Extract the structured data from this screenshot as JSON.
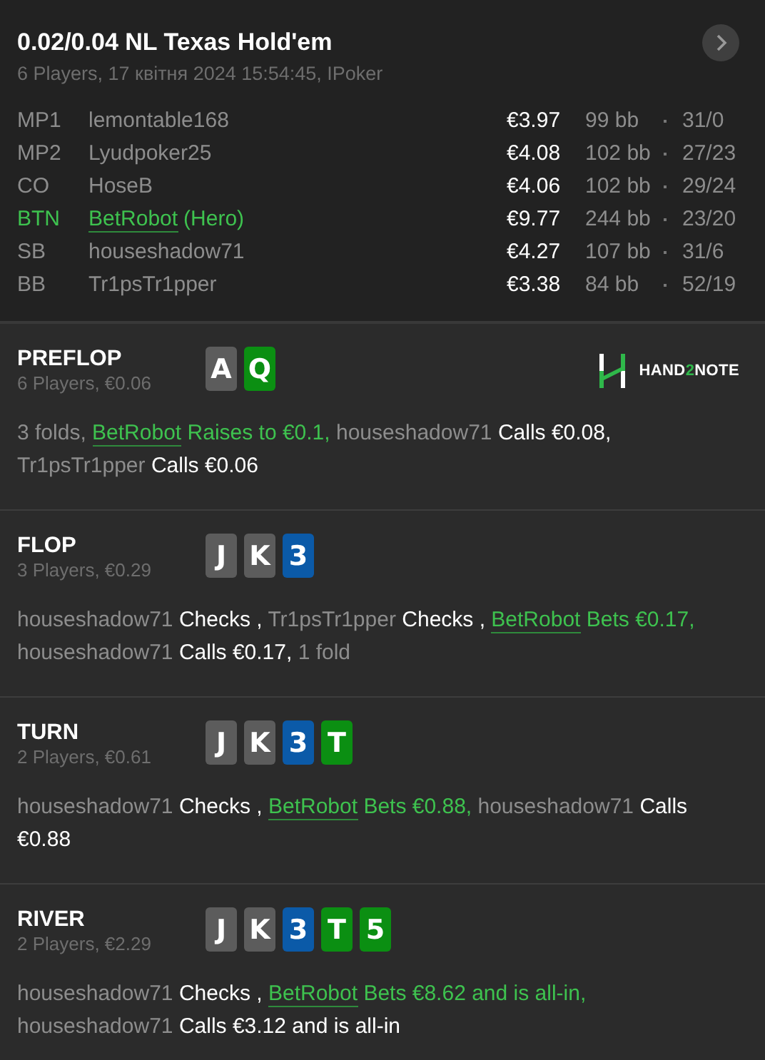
{
  "header": {
    "title": "0.02/0.04 NL Texas Hold'em",
    "subtitle": "6 Players, 17 квітня 2024 15:54:45, IPoker",
    "players": [
      {
        "position": "MP1",
        "name": "lemontable168",
        "hero": false,
        "stack": "€3.97",
        "bb": "99 bb",
        "stats": "31/0"
      },
      {
        "position": "MP2",
        "name": "Lyudpoker25",
        "hero": false,
        "stack": "€4.08",
        "bb": "102 bb",
        "stats": "27/23"
      },
      {
        "position": "CO",
        "name": "HoseB",
        "hero": false,
        "stack": "€4.06",
        "bb": "102 bb",
        "stats": "29/24"
      },
      {
        "position": "BTN",
        "name": "BetRobot",
        "tag": "(Hero)",
        "hero": true,
        "stack": "€9.77",
        "bb": "244 bb",
        "stats": "23/20"
      },
      {
        "position": "SB",
        "name": "houseshadow71",
        "hero": false,
        "stack": "€4.27",
        "bb": "107 bb",
        "stats": "31/6"
      },
      {
        "position": "BB",
        "name": "Tr1psTr1pper",
        "hero": false,
        "stack": "€3.38",
        "bb": "84 bb",
        "stats": "52/19"
      }
    ]
  },
  "logo_text": [
    "HAND",
    "2",
    "NOTE"
  ],
  "streets": [
    {
      "name": "PREFLOP",
      "info": "6 Players, €0.06",
      "logo": true,
      "cards": [
        {
          "rank": "A",
          "color": "#5c5c5c"
        },
        {
          "rank": "Q",
          "color": "#0b8f12"
        }
      ],
      "actions": [
        {
          "kind": "muted",
          "text": "3 folds,"
        },
        {
          "kind": "hero",
          "text": "BetRobot"
        },
        {
          "kind": "hero-action",
          "text": "Raises to €0.1,"
        },
        {
          "kind": "muted",
          "text": "houseshadow71"
        },
        {
          "kind": "action",
          "text": "Calls €0.08,"
        },
        {
          "kind": "muted",
          "text": "Tr1psTr1pper"
        },
        {
          "kind": "action",
          "text": "Calls €0.06"
        }
      ]
    },
    {
      "name": "FLOP",
      "info": "3 Players, €0.29",
      "logo": false,
      "cards": [
        {
          "rank": "J",
          "color": "#5c5c5c"
        },
        {
          "rank": "K",
          "color": "#5c5c5c"
        },
        {
          "rank": "3",
          "color": "#0b5aa8"
        }
      ],
      "actions": [
        {
          "kind": "muted",
          "text": "houseshadow71"
        },
        {
          "kind": "action",
          "text": "Checks ,"
        },
        {
          "kind": "muted",
          "text": "Tr1psTr1pper"
        },
        {
          "kind": "action",
          "text": "Checks ,"
        },
        {
          "kind": "hero",
          "text": "BetRobot"
        },
        {
          "kind": "hero-action",
          "text": "Bets €0.17,"
        },
        {
          "kind": "muted",
          "text": "houseshadow71"
        },
        {
          "kind": "action",
          "text": "Calls €0.17,"
        },
        {
          "kind": "muted",
          "text": "1 fold"
        }
      ]
    },
    {
      "name": "TURN",
      "info": "2 Players, €0.61",
      "logo": false,
      "cards": [
        {
          "rank": "J",
          "color": "#5c5c5c"
        },
        {
          "rank": "K",
          "color": "#5c5c5c"
        },
        {
          "rank": "3",
          "color": "#0b5aa8"
        },
        {
          "rank": "T",
          "color": "#0b8f12"
        }
      ],
      "actions": [
        {
          "kind": "muted",
          "text": "houseshadow71"
        },
        {
          "kind": "action",
          "text": "Checks ,"
        },
        {
          "kind": "hero",
          "text": "BetRobot"
        },
        {
          "kind": "hero-action",
          "text": "Bets €0.88,"
        },
        {
          "kind": "muted",
          "text": "houseshadow71"
        },
        {
          "kind": "action",
          "text": "Calls €0.88"
        }
      ]
    },
    {
      "name": "RIVER",
      "info": "2 Players, €2.29",
      "logo": false,
      "cards": [
        {
          "rank": "J",
          "color": "#5c5c5c"
        },
        {
          "rank": "K",
          "color": "#5c5c5c"
        },
        {
          "rank": "3",
          "color": "#0b5aa8"
        },
        {
          "rank": "T",
          "color": "#0b8f12"
        },
        {
          "rank": "5",
          "color": "#0b8f12"
        }
      ],
      "actions": [
        {
          "kind": "muted",
          "text": "houseshadow71"
        },
        {
          "kind": "action",
          "text": "Checks ,"
        },
        {
          "kind": "hero",
          "text": "BetRobot"
        },
        {
          "kind": "hero-action",
          "text": "Bets €8.62 and is all-in,"
        },
        {
          "kind": "muted",
          "text": "houseshadow71"
        },
        {
          "kind": "action",
          "text": "Calls €3.12 and is all-in"
        }
      ]
    }
  ]
}
